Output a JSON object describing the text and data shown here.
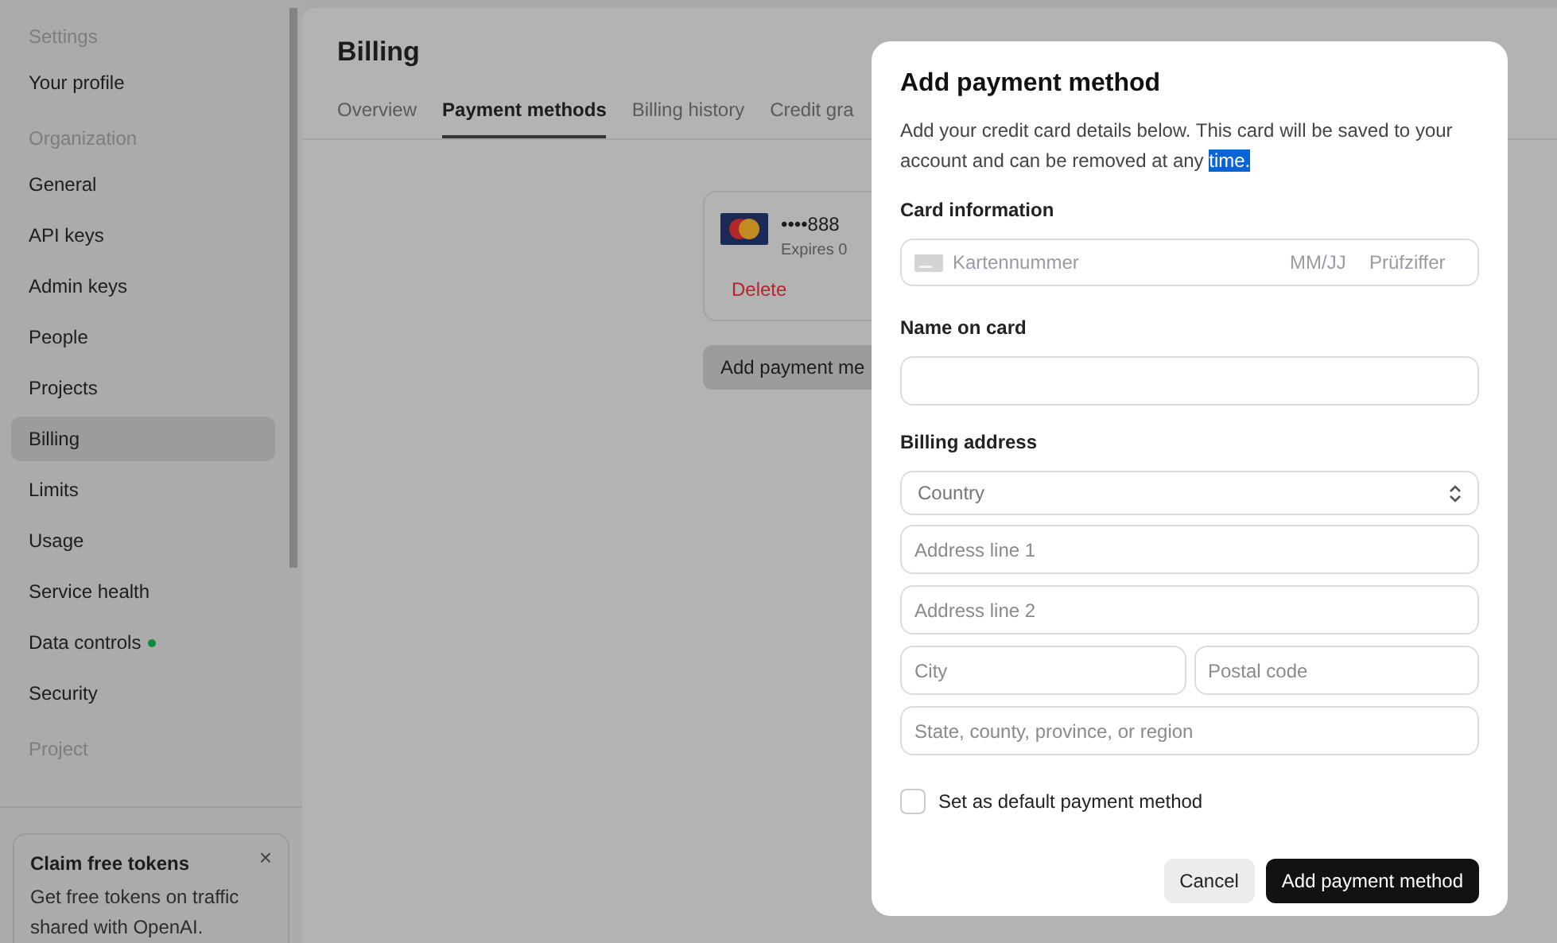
{
  "sidebar": {
    "sections": [
      {
        "heading": "Settings",
        "items": [
          {
            "label": "Your profile",
            "selected": false
          }
        ]
      },
      {
        "heading": "Organization",
        "items": [
          {
            "label": "General",
            "selected": false
          },
          {
            "label": "API keys",
            "selected": false
          },
          {
            "label": "Admin keys",
            "selected": false
          },
          {
            "label": "People",
            "selected": false
          },
          {
            "label": "Projects",
            "selected": false
          },
          {
            "label": "Billing",
            "selected": true
          },
          {
            "label": "Limits",
            "selected": false
          },
          {
            "label": "Usage",
            "selected": false
          },
          {
            "label": "Service health",
            "selected": false
          },
          {
            "label": "Data controls",
            "selected": false,
            "color": "#0f8a3c"
          },
          {
            "label": "Security",
            "selected": false
          }
        ]
      },
      {
        "heading": "Project"
      }
    ],
    "promo": {
      "title": "Claim free tokens",
      "text": "Get free tokens on traffic shared with OpenAI.",
      "close": "×"
    }
  },
  "page": {
    "title": "Billing",
    "tabs": [
      {
        "label": "Overview",
        "selected": false
      },
      {
        "label": "Payment methods",
        "selected": true
      },
      {
        "label": "Billing history",
        "selected": false
      },
      {
        "label": "Credit gra",
        "selected": false
      }
    ],
    "card": {
      "number": "••••888",
      "expires": "Expires 0",
      "delete": "Delete"
    },
    "add_button": "Add payment me"
  },
  "dialog": {
    "title": "Add payment method",
    "description": "Add your credit card details below. This card will be saved to your account and can be removed at any ",
    "description_highlighted": "time.",
    "card_label": "Card information",
    "card_number_placeholder": "Kartennummer",
    "expiry_placeholder": "MM/JJ",
    "cvc_placeholder": "Prüfziffer",
    "name_label": "Name on card",
    "address_label": "Billing address",
    "country_placeholder": "Country",
    "line1_placeholder": "Address line 1",
    "line2_placeholder": "Address line 2",
    "city_placeholder": "City",
    "postal_placeholder": "Postal code",
    "region_placeholder": "State, county, province, or region",
    "default_checkbox": {
      "label": "Set as default payment method",
      "checked": false
    },
    "cancel": "Cancel",
    "submit": "Add payment method"
  }
}
